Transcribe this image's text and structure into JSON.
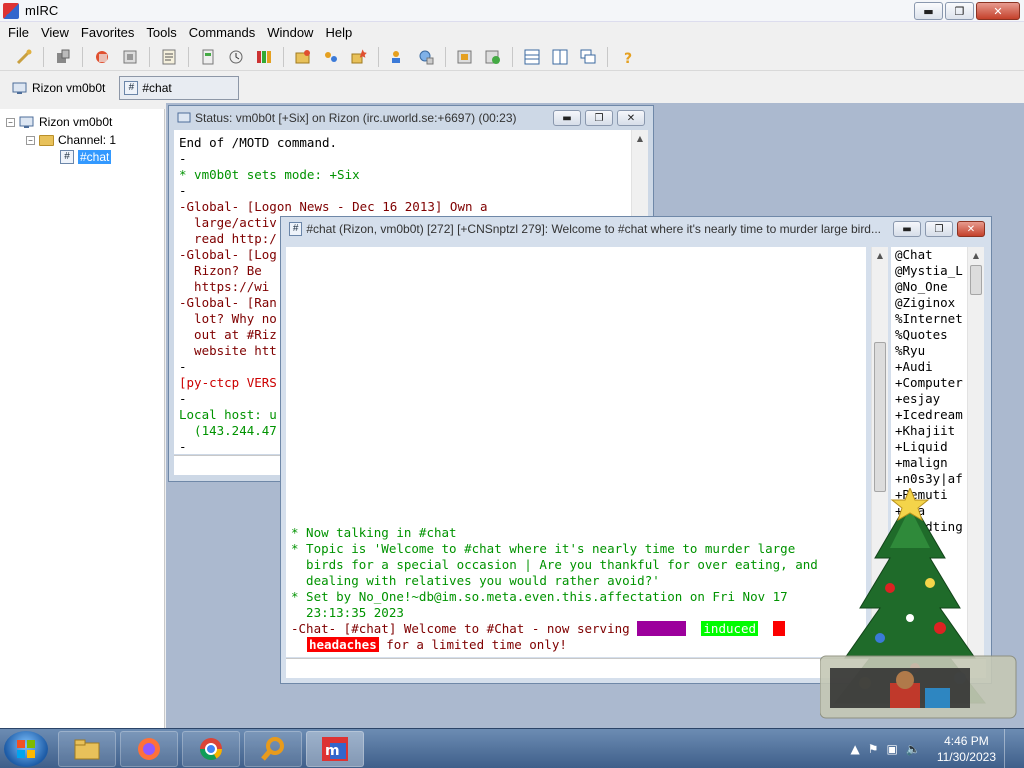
{
  "app": {
    "title": "mIRC"
  },
  "window_controls": {
    "minimize": "▬",
    "maximize": "❐",
    "close": "✕"
  },
  "menubar": [
    "File",
    "View",
    "Favorites",
    "Tools",
    "Commands",
    "Window",
    "Help"
  ],
  "switchbar": {
    "tabs": [
      {
        "label": "Rizon vm0b0t",
        "active": false
      },
      {
        "label": "#chat",
        "active": true
      }
    ]
  },
  "treebar": {
    "server": "Rizon vm0b0t",
    "folder": "Channel: 1",
    "channel": "#chat"
  },
  "status_window": {
    "title": "Status: vm0b0t [+Six] on Rizon (irc.uworld.se:+6697) (00:23)",
    "lines": [
      {
        "text": "End of /MOTD command.",
        "color": "dark"
      },
      {
        "text": "-",
        "color": "dark"
      },
      {
        "text": "* vm0b0t sets mode: +Six",
        "color": "green"
      },
      {
        "text": "-",
        "color": "dark"
      },
      {
        "text": "-Global- [Logon News - Dec 16 2013] Own a",
        "color": "red"
      },
      {
        "text": "  large/activ",
        "color": "red"
      },
      {
        "text": "  read http:/",
        "color": "red"
      },
      {
        "text": "-Global- [Log",
        "color": "red"
      },
      {
        "text": "  Rizon? Be",
        "color": "red"
      },
      {
        "text": "  https://wi",
        "color": "red"
      },
      {
        "text": "-Global- [Ran",
        "color": "red"
      },
      {
        "text": "  lot? Why no",
        "color": "red"
      },
      {
        "text": "  out at #Riz",
        "color": "red"
      },
      {
        "text": "  website htt",
        "color": "red"
      },
      {
        "text": "-",
        "color": "dark"
      },
      {
        "text": "[py-ctcp VERS",
        "color": "bright-red"
      },
      {
        "text": "-",
        "color": "dark"
      },
      {
        "text": "Local host: u",
        "color": "green"
      },
      {
        "text": "  (143.244.47",
        "color": "green"
      },
      {
        "text": "-",
        "color": "dark"
      }
    ]
  },
  "chat_window": {
    "title": "#chat (Rizon, vm0b0t) [272] [+CNSnptzl 279]: Welcome to #chat where it's nearly time to murder large bird...",
    "lines": [
      {
        "text": "* Now talking in #chat",
        "color": "green"
      },
      {
        "text": "* Topic is 'Welcome to #chat where it's nearly time to murder large",
        "color": "green"
      },
      {
        "text": "  birds for a special occasion | Are you thankful for over eating, and",
        "color": "green"
      },
      {
        "text": "  dealing with relatives you would rather avoid?'",
        "color": "green"
      },
      {
        "text": "* Set by No_One!~db@im.so.meta.even.this.affectation on Fri Nov 17",
        "color": "green"
      },
      {
        "text": "  23:13:35 2023",
        "color": "green"
      }
    ],
    "notice_prefix": "-Chat- [#chat] Welcome to #Chat - now serving",
    "notice_badge1": "turkey",
    "notice_badge2": "induced",
    "notice_badge3": "headaches",
    "notice_suffix": "for a limited time only!"
  },
  "nicklist": [
    "@Chat",
    "@Mystia_L",
    "@No_One",
    "@Ziginox",
    "%Internet",
    "%Quotes",
    "%Ryu",
    "+Audi",
    "+Computer",
    "+esjay",
    "+Icedream",
    "+Khajiit",
    "+Liquid",
    "+malign",
    "+n0s3y|af",
    "+Remuti",
    "+Rya",
    "+Sildting"
  ],
  "taskbar": {
    "clock_time": "4:46 PM",
    "clock_date": "11/30/2023"
  },
  "colors": {
    "irc_green": "#009300",
    "irc_red": "#7f0000",
    "selection": "#3399ff"
  }
}
